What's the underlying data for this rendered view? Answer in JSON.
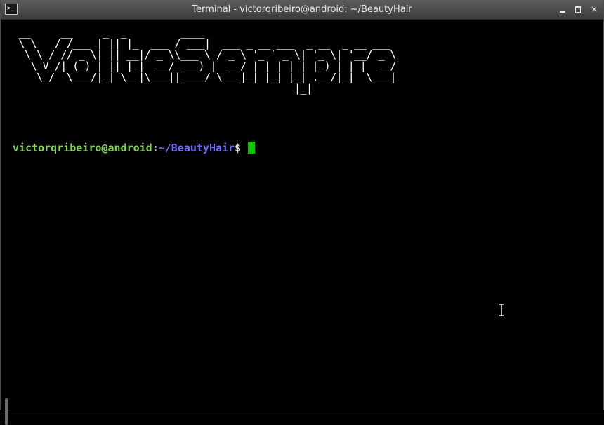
{
  "window": {
    "title": "Terminal - victorqribeiro@android: ~/BeautyHair",
    "controls": {
      "minimize": "minimize",
      "maximize": "maximize",
      "close": "×"
    },
    "app_icon_text": ">_"
  },
  "terminal": {
    "banner_ascii": " __     __     _  _         ____                                  \n \\ \\   / /___ | || |_  ___ / ___|  ___ _ __ ___  _ __  _ __ ___   \n  \\ \\ / // _ \\| || __|/ _ \\\\___ \\ / _ \\ '_ ` _ \\| '_ \\| '__/ _ \\  \n   \\ V /| (_) | || |_|  __/ ___) |  __/ | | | | | |_) | | |  __/  \n    \\_/  \\___/|_| \\__|\\___||____/ \\___|_| |_| |_| .__/|_|  \\___|  \n                                               |_|               ",
    "banner_text": "VolteSempre",
    "prompt": {
      "user_host": "victorqribeiro@android",
      "separator": ":",
      "path": "~/BeautyHair",
      "symbol": "$ "
    }
  },
  "colors": {
    "background": "#000000",
    "prompt_user": "#7fd84a",
    "prompt_path": "#6b6bff",
    "cursor": "#11c400",
    "titlebar": "#4a4a4a"
  }
}
